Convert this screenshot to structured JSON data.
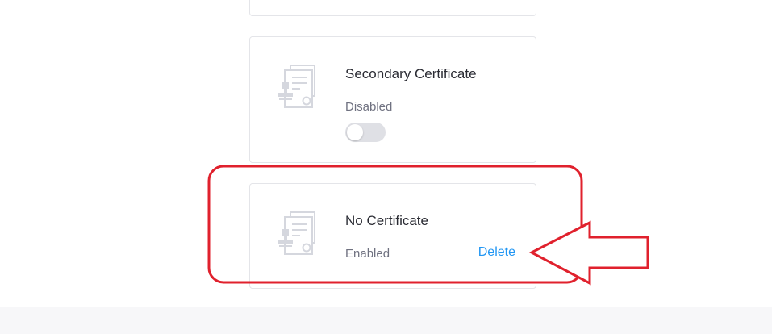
{
  "certificates": [
    {
      "title": "Secondary Certificate",
      "status": "Disabled",
      "toggle_on": false,
      "icon": "certificate-icon"
    },
    {
      "title": "No Certificate",
      "status": "Enabled",
      "action_label": "Delete",
      "icon": "certificate-icon"
    }
  ],
  "colors": {
    "highlight": "#e0212d",
    "link": "#2196f3"
  }
}
